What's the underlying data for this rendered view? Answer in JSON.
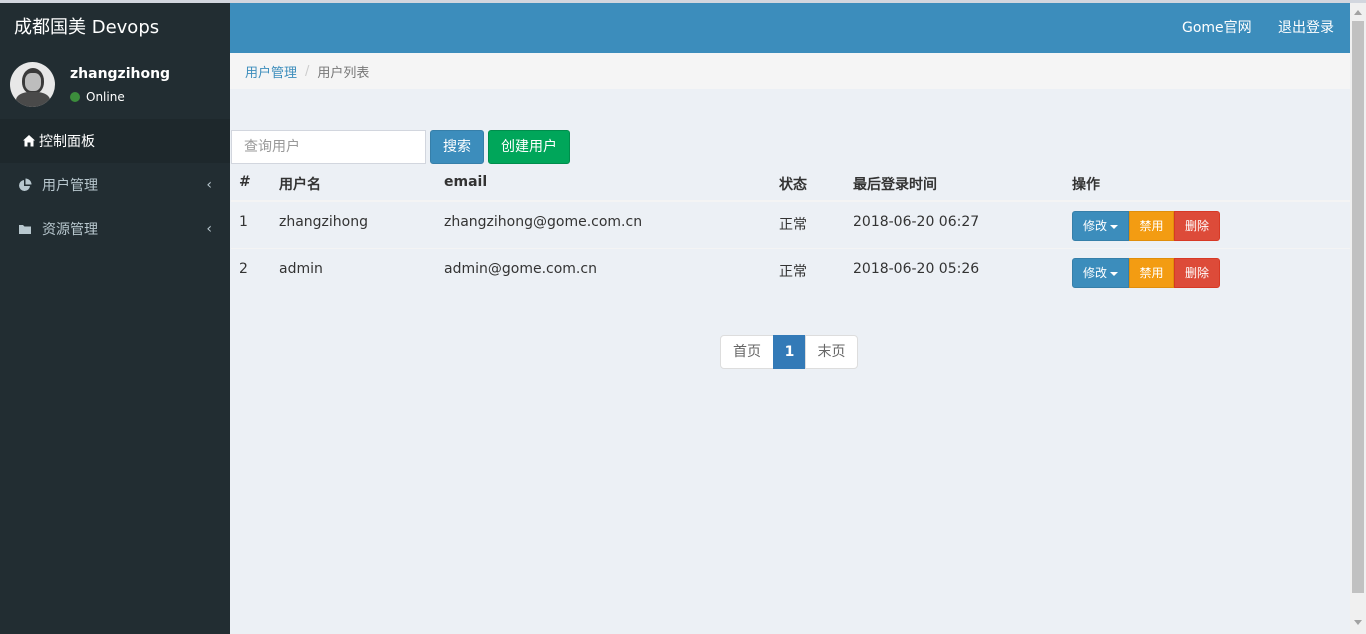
{
  "sidebar": {
    "logo": "成都国美 Devops",
    "user": {
      "name": "zhangzihong",
      "status": "Online"
    },
    "items": [
      {
        "label": "控制面板",
        "icon": "home-icon"
      },
      {
        "label": "用户管理",
        "icon": "pie-chart-icon"
      },
      {
        "label": "资源管理",
        "icon": "folder-icon"
      }
    ]
  },
  "header": {
    "links": [
      "Gome官网",
      "退出登录"
    ]
  },
  "breadcrumb": {
    "parent": "用户管理",
    "current": "用户列表"
  },
  "search": {
    "placeholder": "查询用户",
    "button": "搜索",
    "create_button": "创建用户"
  },
  "table": {
    "columns": [
      "#",
      "用户名",
      "email",
      "状态",
      "最后登录时间",
      "操作"
    ],
    "rows": [
      {
        "id": "1",
        "username": "zhangzihong",
        "email": "zhangzihong@gome.com.cn",
        "status": "正常",
        "last_login": "2018-06-20 06:27"
      },
      {
        "id": "2",
        "username": "admin",
        "email": "admin@gome.com.cn",
        "status": "正常",
        "last_login": "2018-06-20 05:26"
      }
    ],
    "actions": {
      "edit": "修改",
      "disable": "禁用",
      "delete": "删除"
    }
  },
  "pagination": {
    "first": "首页",
    "current": "1",
    "last": "末页"
  },
  "colors": {
    "primary": "#3c8dbc",
    "success": "#00a65a",
    "warning": "#f39c12",
    "danger": "#dd4b39",
    "sidebar": "#222d32"
  }
}
